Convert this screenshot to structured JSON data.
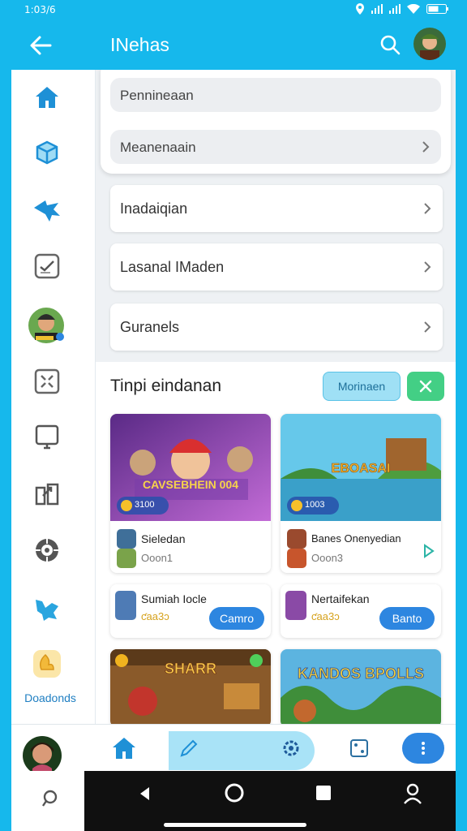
{
  "status": {
    "time": "1:03/6"
  },
  "appbar": {
    "title": "INehas"
  },
  "sidebar": {
    "items": [
      {
        "icon": "home-icon"
      },
      {
        "icon": "box-icon"
      },
      {
        "icon": "plane-icon"
      },
      {
        "icon": "tasks-icon"
      },
      {
        "icon": "profile-avatar"
      },
      {
        "icon": "grid-icon"
      },
      {
        "icon": "monitor-icon"
      },
      {
        "icon": "share-icon"
      },
      {
        "icon": "settings-icon"
      },
      {
        "icon": "tool-icon"
      },
      {
        "icon": "downloads-icon"
      }
    ],
    "downloads_label": "Doadonds"
  },
  "settings": {
    "top_card": {
      "field1": "Pennineaan",
      "field2": "Meanenaain"
    },
    "rows": [
      "Inadaiqian",
      "Lasanal IMaden",
      "Guranels"
    ]
  },
  "games_section": {
    "title": "Tinpi eindanan",
    "more_label": "Morinaen",
    "cards": [
      {
        "art_title": "CAVSEBHEIN 004",
        "badge": "3100",
        "name": "Sieledan",
        "sub": "Ooon1"
      },
      {
        "art_title": "EBOASAI",
        "badge": "1003",
        "name": "Banes Onenyedian",
        "sub": "Ooon3"
      },
      {
        "name": "Sumiah Iocle",
        "sub": "ƈaa3ɔ",
        "button": "Camro"
      },
      {
        "name": "Nertaifekan",
        "sub": "ƈaa3ɔ",
        "button": "Banto"
      },
      {
        "art_title": "SHARR"
      },
      {
        "art_title": "KANDOS BPOLLS"
      }
    ]
  },
  "colors": {
    "primary": "#16b8ec",
    "accent": "#2d86e0",
    "green": "#43cf85"
  }
}
